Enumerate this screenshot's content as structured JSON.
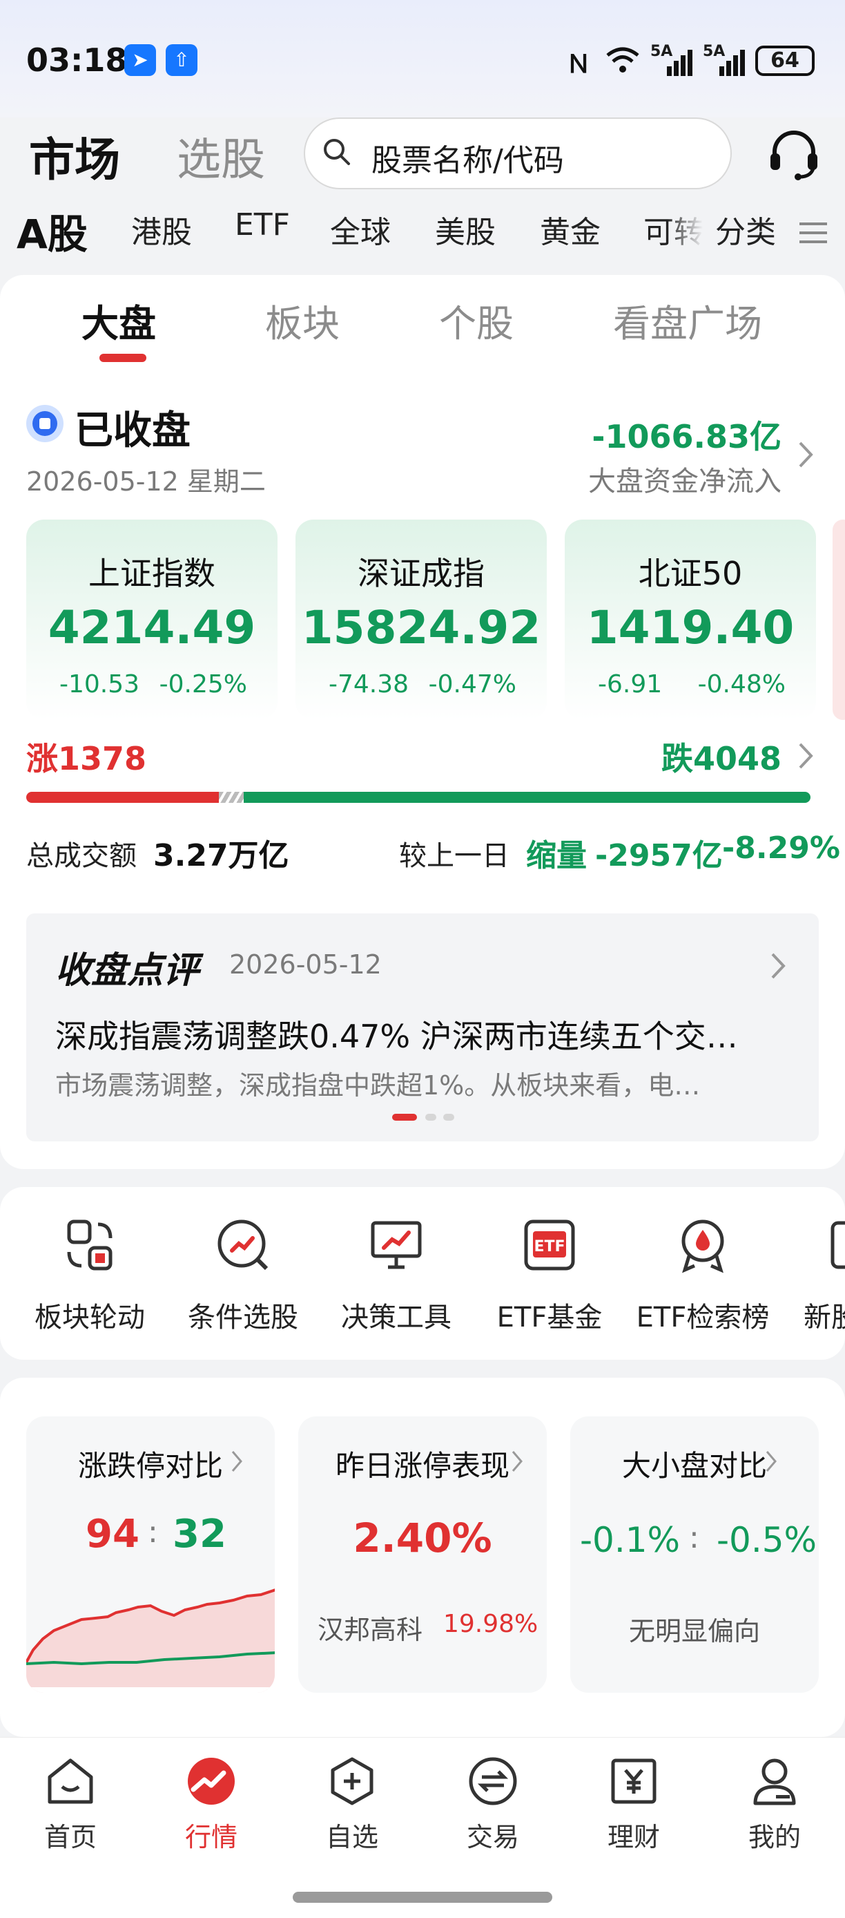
{
  "status_bar": {
    "time": "03:18",
    "signal1": "5A",
    "signal2": "5A",
    "battery": "64"
  },
  "header": {
    "title": "市场",
    "tab2": "选股",
    "search_placeholder": "股票名称/代码"
  },
  "category_tabs": [
    "A股",
    "港股",
    "ETF",
    "全球",
    "美股",
    "黄金",
    "可转",
    "分类"
  ],
  "sub_tabs": [
    "大盘",
    "板块",
    "个股",
    "看盘广场"
  ],
  "market": {
    "status": "已收盘",
    "date": "2026-05-12 星期二",
    "net_flow": "-1066.83亿",
    "net_flow_label": "大盘资金净流入"
  },
  "indices": [
    {
      "name": "上证指数",
      "value": "4214.49",
      "change": "-10.53",
      "pct": "-0.25%"
    },
    {
      "name": "深证成指",
      "value": "15824.92",
      "change": "-74.38",
      "pct": "-0.47%"
    },
    {
      "name": "北证50",
      "value": "1419.40",
      "change": "-6.91",
      "pct": "-0.48%"
    }
  ],
  "breadth": {
    "up_label": "涨",
    "up": "1378",
    "down_label": "跌",
    "down": "4048",
    "up_fraction": 0.254,
    "up_color": "#e03131",
    "down_color": "#129a5a"
  },
  "turnover": {
    "label": "总成交额",
    "value": "3.27万亿",
    "cmp_label": "较上一日",
    "cmp_kind": "缩量",
    "cmp_value": "-2957亿",
    "cmp_pct": "-8.29%"
  },
  "commentary": {
    "logo": "收盘点评",
    "date": "2026-05-12",
    "headline": "深成指震荡调整跌0.47% 沪深两市连续五个交…",
    "summary": "市场震荡调整，深成指盘中跌超1%。从板块来看，电…"
  },
  "tools": [
    {
      "label": "板块轮动",
      "icon": "sector-rotation-icon"
    },
    {
      "label": "条件选股",
      "icon": "condition-picker-icon"
    },
    {
      "label": "决策工具",
      "icon": "decision-tool-icon"
    },
    {
      "label": "ETF基金",
      "icon": "etf-fund-icon"
    },
    {
      "label": "ETF检索榜",
      "icon": "etf-ranking-icon"
    },
    {
      "label": "新股",
      "icon": "new-stock-icon"
    }
  ],
  "compare_cards": {
    "limit": {
      "title": "涨跌停对比",
      "up": "94",
      "sep": ":",
      "down": "32"
    },
    "yesterday": {
      "title": "昨日涨停表现",
      "pct": "2.40%",
      "stock": "汉邦高科",
      "stock_pct": "19.98%"
    },
    "size": {
      "title": "大小盘对比",
      "left": "-0.1%",
      "sep": ":",
      "right": "-0.5%",
      "note": "无明显偏向"
    }
  },
  "bottom_nav": [
    {
      "label": "首页",
      "icon": "home-icon"
    },
    {
      "label": "行情",
      "icon": "market-icon"
    },
    {
      "label": "自选",
      "icon": "watchlist-icon"
    },
    {
      "label": "交易",
      "icon": "trade-icon"
    },
    {
      "label": "理财",
      "icon": "wealth-icon"
    },
    {
      "label": "我的",
      "icon": "profile-icon"
    }
  ],
  "colors": {
    "accent_red": "#e03131",
    "accent_green": "#129a5a",
    "background": "#f2f3f5"
  }
}
